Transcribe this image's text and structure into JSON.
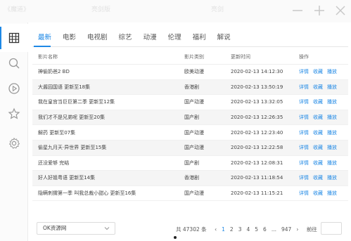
{
  "ghost_header": {
    "left": "《魔道》",
    "middle": "亮剑版",
    "right": "亮剑"
  },
  "sidebar": {
    "items": [
      {
        "icon": "film-grid-icon"
      },
      {
        "icon": "search-icon"
      },
      {
        "icon": "play-icon"
      },
      {
        "icon": "star-icon"
      },
      {
        "icon": "gear-icon"
      }
    ]
  },
  "tabs": [
    "最新",
    "电影",
    "电视剧",
    "综艺",
    "动漫",
    "伦理",
    "福利",
    "解说"
  ],
  "table": {
    "headers": [
      "影片名称",
      "影片类别",
      "更新时间",
      "操作"
    ],
    "ops": [
      "详情",
      "收藏",
      "播放"
    ],
    "rows": [
      {
        "name": "神偷奶爸2 BD",
        "type": "欧美动漫",
        "time": "2020-02-13 14:12:30"
      },
      {
        "name": "大酱园国语 更新至18集",
        "type": "香港剧",
        "time": "2020-02-13 13:50:19"
      },
      {
        "name": "我在皇宫当巨巨第二季 更新至12集",
        "type": "国产动漫",
        "time": "2020-02-13 13:32:05"
      },
      {
        "name": "我们才不是兄弟呢 更新至20集",
        "type": "国产剧",
        "time": "2020-02-13 12:26:35"
      },
      {
        "name": "解药 更新至07集",
        "type": "国产动漫",
        "time": "2020-02-13 12:23:40"
      },
      {
        "name": "偷星九月天·异世界 更新至15集",
        "type": "国产动漫",
        "time": "2020-02-13 12:22:58"
      },
      {
        "name": "还没爱够 完结",
        "type": "国产剧",
        "time": "2020-02-13 12:08:31"
      },
      {
        "name": "好人好姐粤语 更新至14集",
        "type": "香港剧",
        "time": "2020-02-13 11:18:54"
      },
      {
        "name": "隐瞒刺猬第一季 叫我总裁小甜心 更新至16集",
        "type": "国产动漫",
        "time": "2020-02-13 11:15:21"
      }
    ]
  },
  "footer": {
    "source": "OK资源网",
    "total": "共 47302 条",
    "pages": [
      "1",
      "2",
      "3",
      "4",
      "5",
      "6",
      "...",
      "947"
    ],
    "current_page": "1",
    "goto_label": "前往"
  },
  "colors": {
    "accent": "#1e88e5"
  }
}
